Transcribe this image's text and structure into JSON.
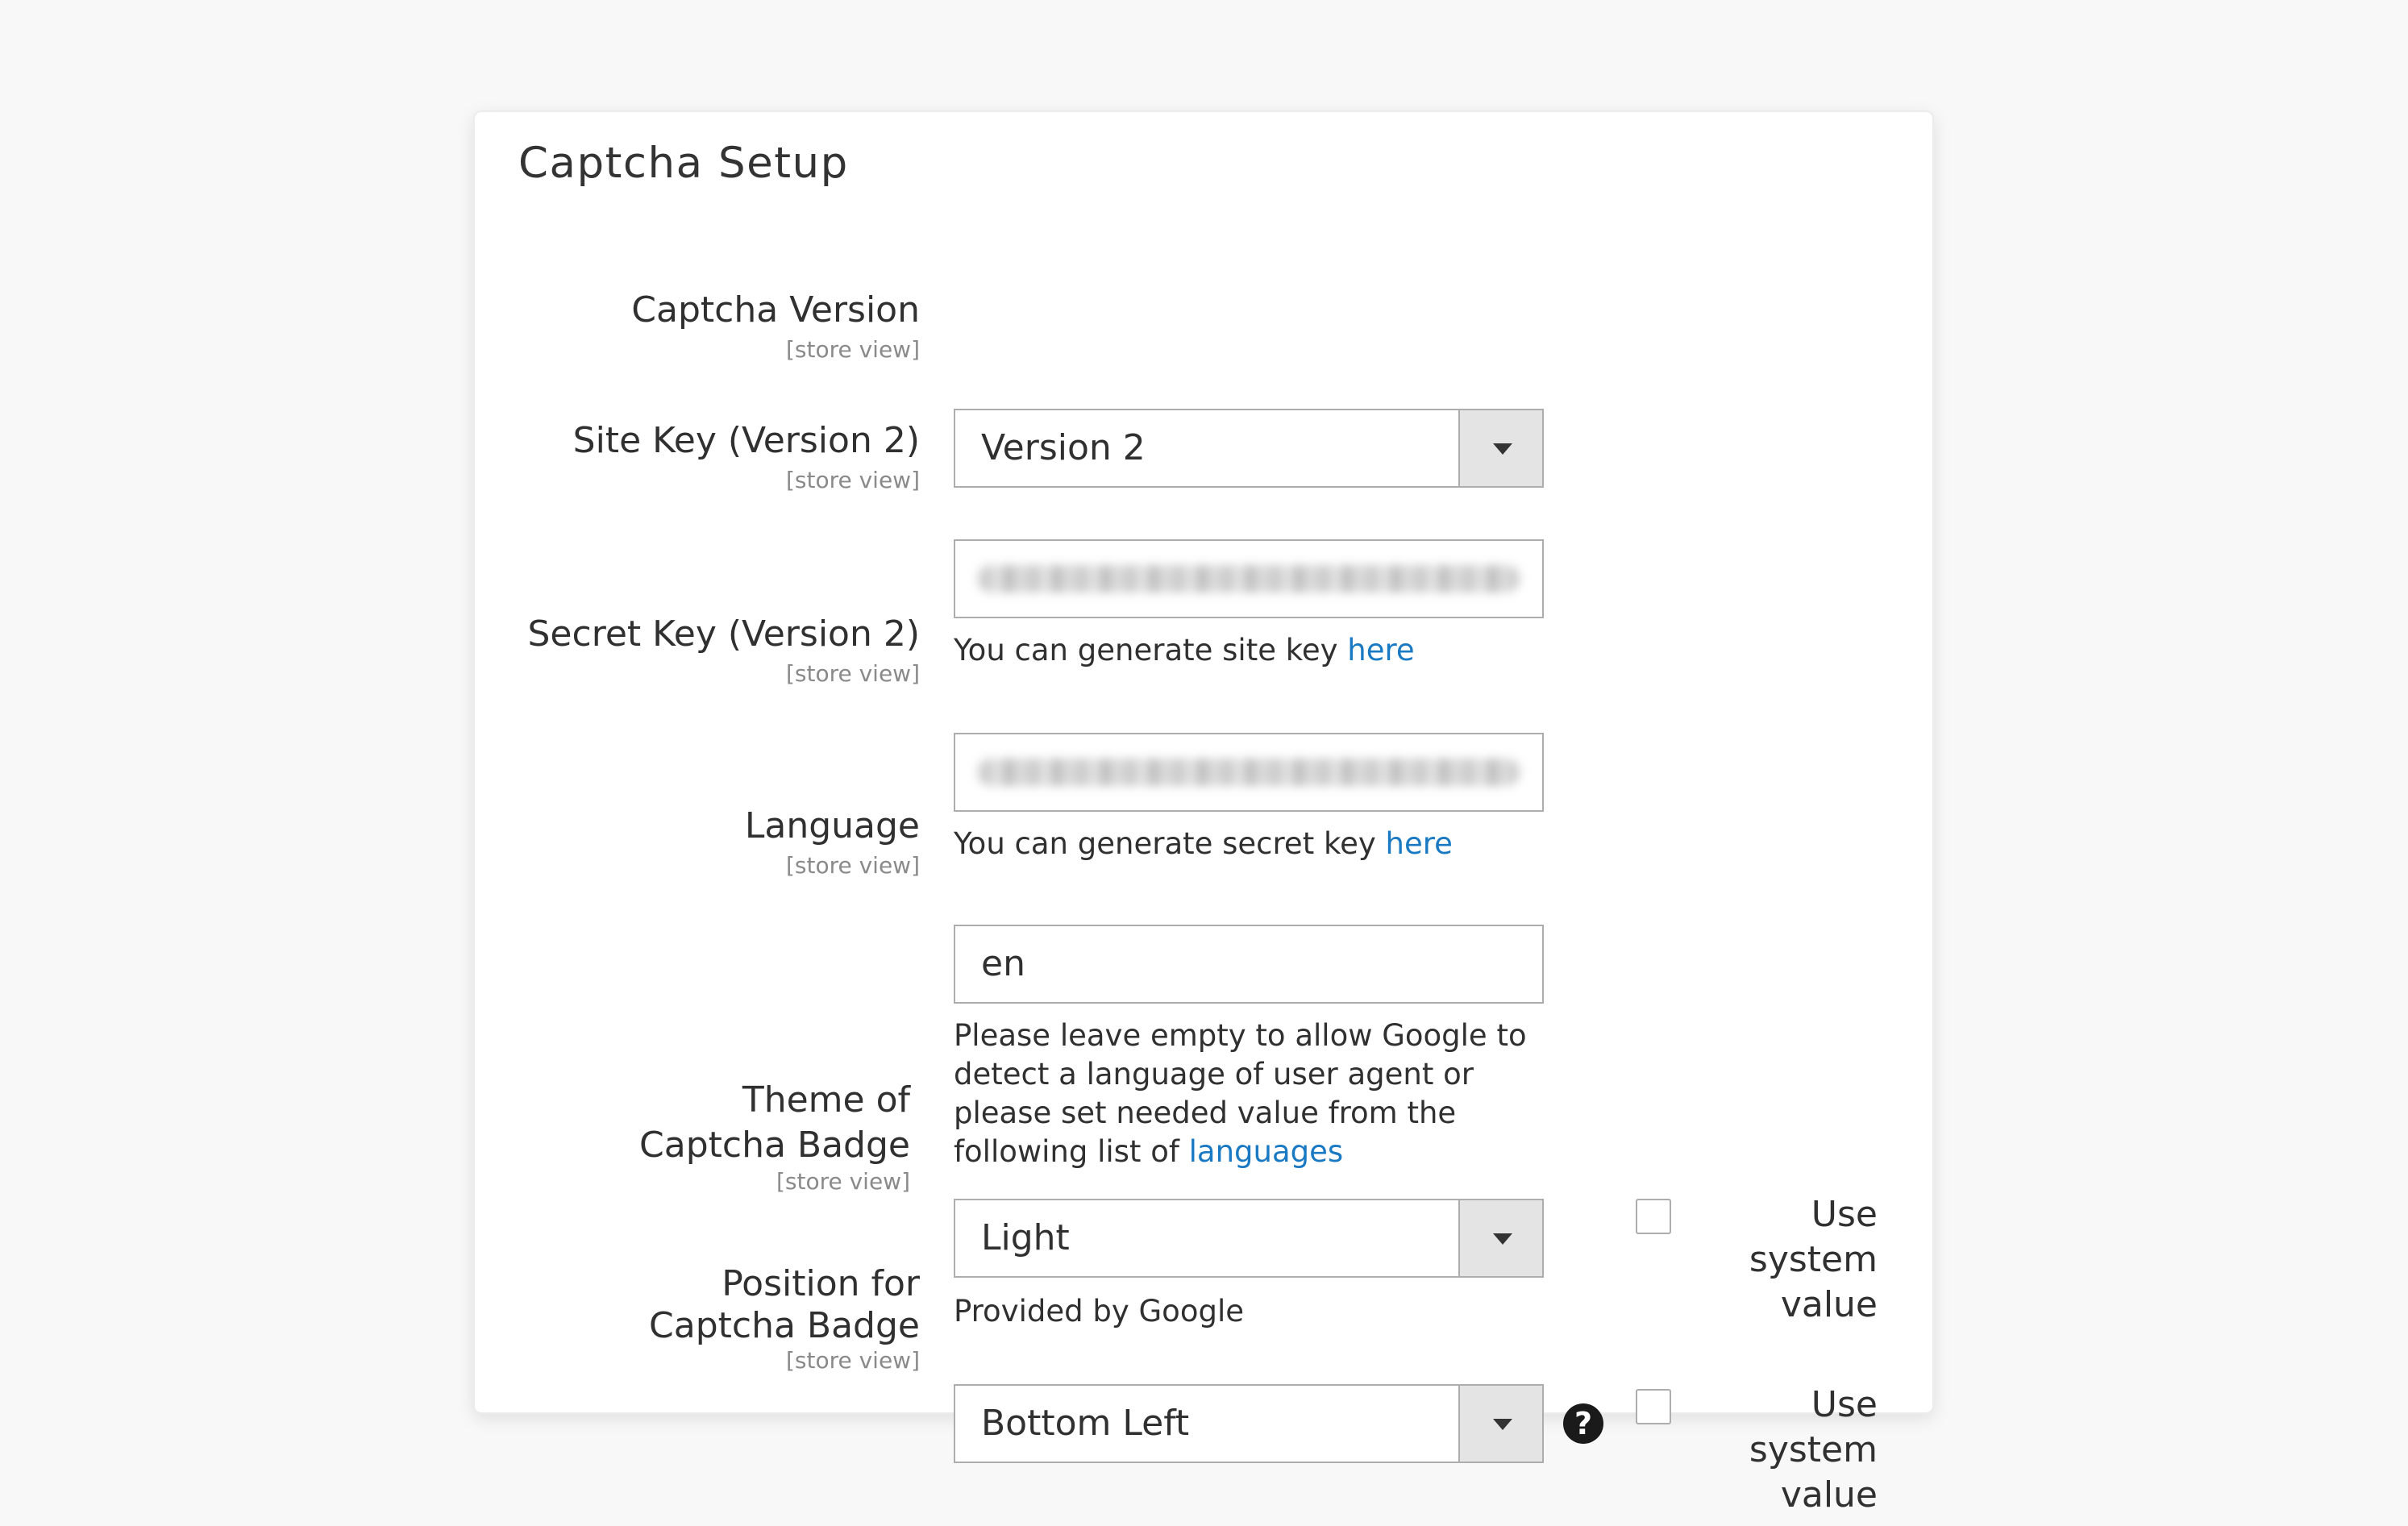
{
  "section": {
    "title": "Captcha Setup"
  },
  "fields": {
    "captcha_version": {
      "label": "Captcha Version",
      "scope": "[store view]",
      "value": "Version 2"
    },
    "site_key": {
      "label": "Site Key (Version 2)",
      "scope": "[store view]",
      "note_text": "You can generate site key ",
      "note_link": "here"
    },
    "secret_key": {
      "label": "Secret Key (Version 2)",
      "scope": "[store view]",
      "note_text": "You can generate secret key ",
      "note_link": "here"
    },
    "language": {
      "label": "Language",
      "scope": "[store view]",
      "value": "en",
      "note_text": "Please leave empty to allow Google to detect a language of user agent or please set needed value from the following list of ",
      "note_link": "languages"
    },
    "badge_theme": {
      "label_line1": "Theme of",
      "label_line2": "Captcha Badge",
      "scope": "[store view]",
      "value": "Light",
      "note_text": "Provided by Google",
      "use_system_line1": "Use system",
      "use_system_line2": "value",
      "use_system_checked": false
    },
    "badge_position": {
      "label_line1": "Position for",
      "label_line2": "Captcha Badge",
      "scope": "[store view]",
      "value": "Bottom Left",
      "help_glyph": "?",
      "use_system_line1": "Use system",
      "use_system_line2": "value",
      "use_system_checked": false
    }
  },
  "colors": {
    "link": "#1979c3",
    "text": "#303030",
    "scope": "#8a8a8a",
    "border": "#adadad",
    "arrow_bg": "#e4e4e4"
  }
}
